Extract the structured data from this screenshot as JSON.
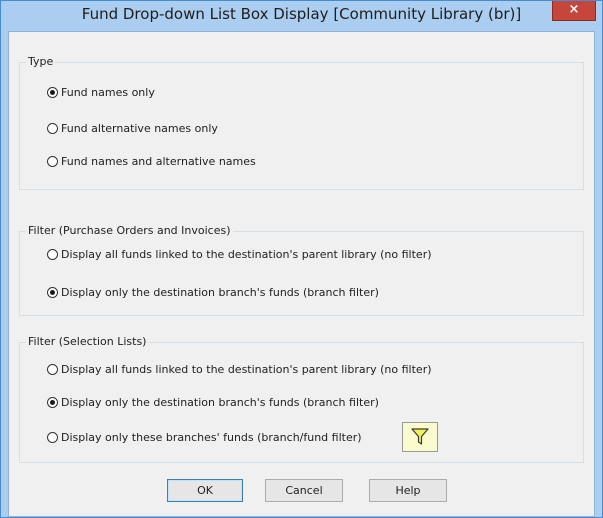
{
  "window": {
    "title": "Fund Drop-down List Box Display [Community Library  (br)]",
    "close_glyph": "×"
  },
  "type_group": {
    "title": "Type",
    "options": [
      {
        "label": "Fund names only",
        "selected": true
      },
      {
        "label": "Fund alternative names only",
        "selected": false
      },
      {
        "label": "Fund names and alternative names",
        "selected": false
      }
    ]
  },
  "po_filter_group": {
    "title": "Filter (Purchase Orders and Invoices)",
    "options": [
      {
        "label": "Display all funds linked to the destination's parent library (no filter)",
        "selected": false
      },
      {
        "label": "Display only the destination branch's funds (branch filter)",
        "selected": true
      }
    ]
  },
  "sl_filter_group": {
    "title": "Filter (Selection Lists)",
    "options": [
      {
        "label": "Display all funds linked to the destination's parent library (no filter)",
        "selected": false
      },
      {
        "label": "Display only the destination branch's funds (branch filter)",
        "selected": true
      },
      {
        "label": "Display only these branches' funds (branch/fund filter)",
        "selected": false
      }
    ],
    "filter_icon": "funnel-icon"
  },
  "buttons": {
    "ok": "OK",
    "cancel": "Cancel",
    "help": "Help"
  },
  "colors": {
    "title_bar": "#aacdf0",
    "close_button": "#c7463b",
    "filter_button": "#fbfbd0",
    "funnel": "#f2f25a"
  }
}
